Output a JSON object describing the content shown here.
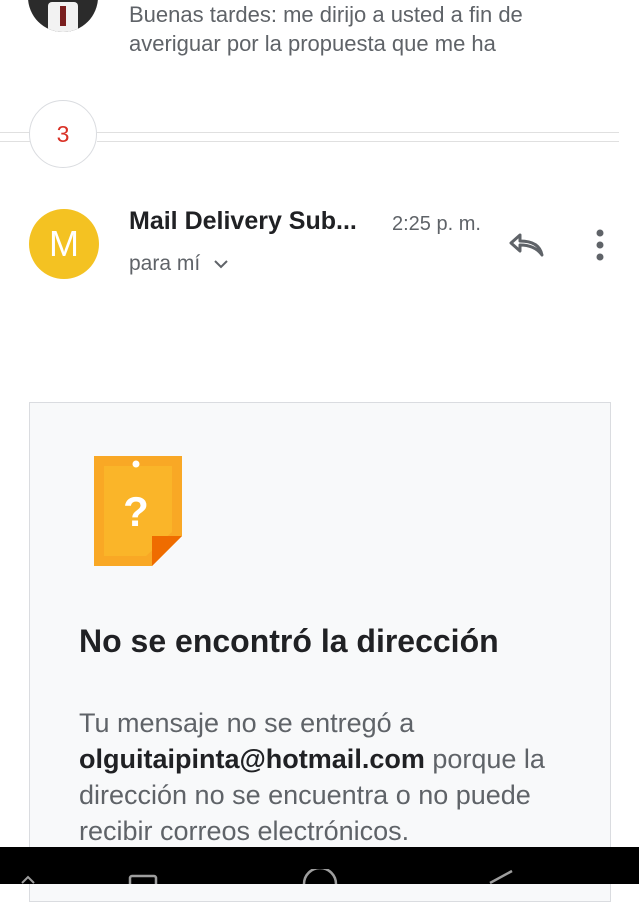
{
  "previous_message": {
    "snippet": "Buenas tardes: me dirijo a usted a fin de averiguar por la propuesta que me ha"
  },
  "collapsed": {
    "count": "3"
  },
  "message": {
    "avatar_letter": "M",
    "sender": "Mail Delivery Sub...",
    "time": "2:25 p. m.",
    "recipient": "para mí"
  },
  "bounce_card": {
    "title": "No se encontró la dirección",
    "body_prefix": "Tu mensaje no se entregó a",
    "email": "olguitaipinta@hotmail.com",
    "body_suffix": "porque la dirección no se encuentra o no puede recibir correos electrónicos."
  },
  "colors": {
    "avatar_bg": "#f4c222",
    "count_text": "#d93025",
    "warn_icon": "#f9a825"
  }
}
